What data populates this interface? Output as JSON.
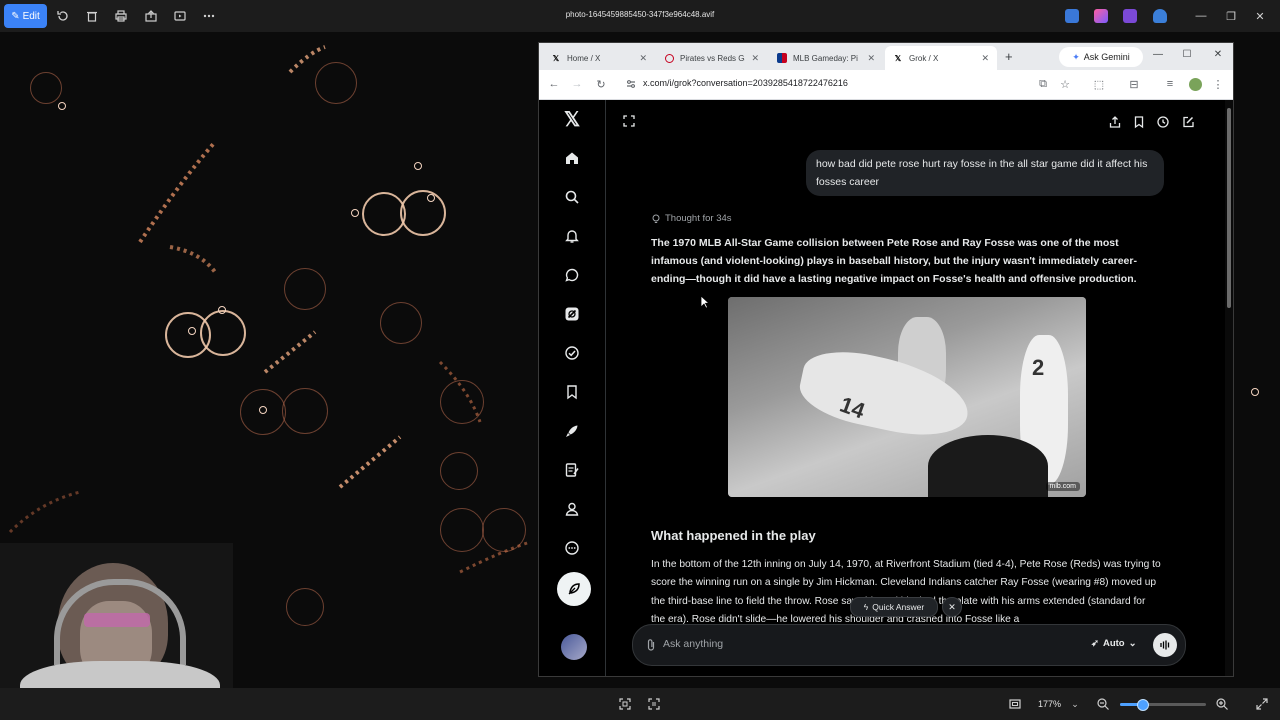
{
  "photos_app": {
    "edit_label": "Edit",
    "file_name": "photo-1645459885450-347f3e964c48.avif",
    "zoom_level": "177%",
    "zoom_fraction": 0.26
  },
  "browser": {
    "tabs": [
      {
        "label": "Home / X",
        "favicon": "x-logo-icon",
        "active": false
      },
      {
        "label": "Pirates vs Reds Ga",
        "favicon": "reds-logo-icon",
        "active": false
      },
      {
        "label": "MLB Gameday: Pi",
        "favicon": "mlb-logo-icon",
        "active": false
      },
      {
        "label": "Grok / X",
        "favicon": "x-logo-icon",
        "active": true
      }
    ],
    "gemini_label": "Ask Gemini",
    "url": "x.com/i/grok?conversation=2039285418722476216"
  },
  "grok": {
    "user_message": "how bad did pete rose hurt ray fosse in the all star game did it affect his fosses career",
    "thought_label": "Thought for 34s",
    "lead_paragraph": "The 1970 MLB All-Star Game collision between Pete Rose and Ray Fosse was one of the most infamous (and violent-looking) plays in baseball history, but the injury wasn't immediately career-ending—though it did have a lasting negative impact on Fosse's health and offensive production.",
    "image_source": "mlb.com",
    "section_heading": "What happened in the play",
    "body_paragraph": "In the bottom of the 12th inning on July 14, 1970, at Riverfront Stadium (tied 4-4), Pete Rose (Reds) was trying to score the winning run on a single by Jim Hickman. Cleveland Indians catcher Ray Fosse (wearing #8) moved up the third-base line to field the throw. Rose saw this and blocked the plate with his arms extended (standard for the era). Rose didn't slide—he lowered his shoulder and crashed into Fosse like a",
    "quick_answer_label": "Quick Answer",
    "ask_placeholder": "Ask anything",
    "mode_label": "Auto"
  }
}
